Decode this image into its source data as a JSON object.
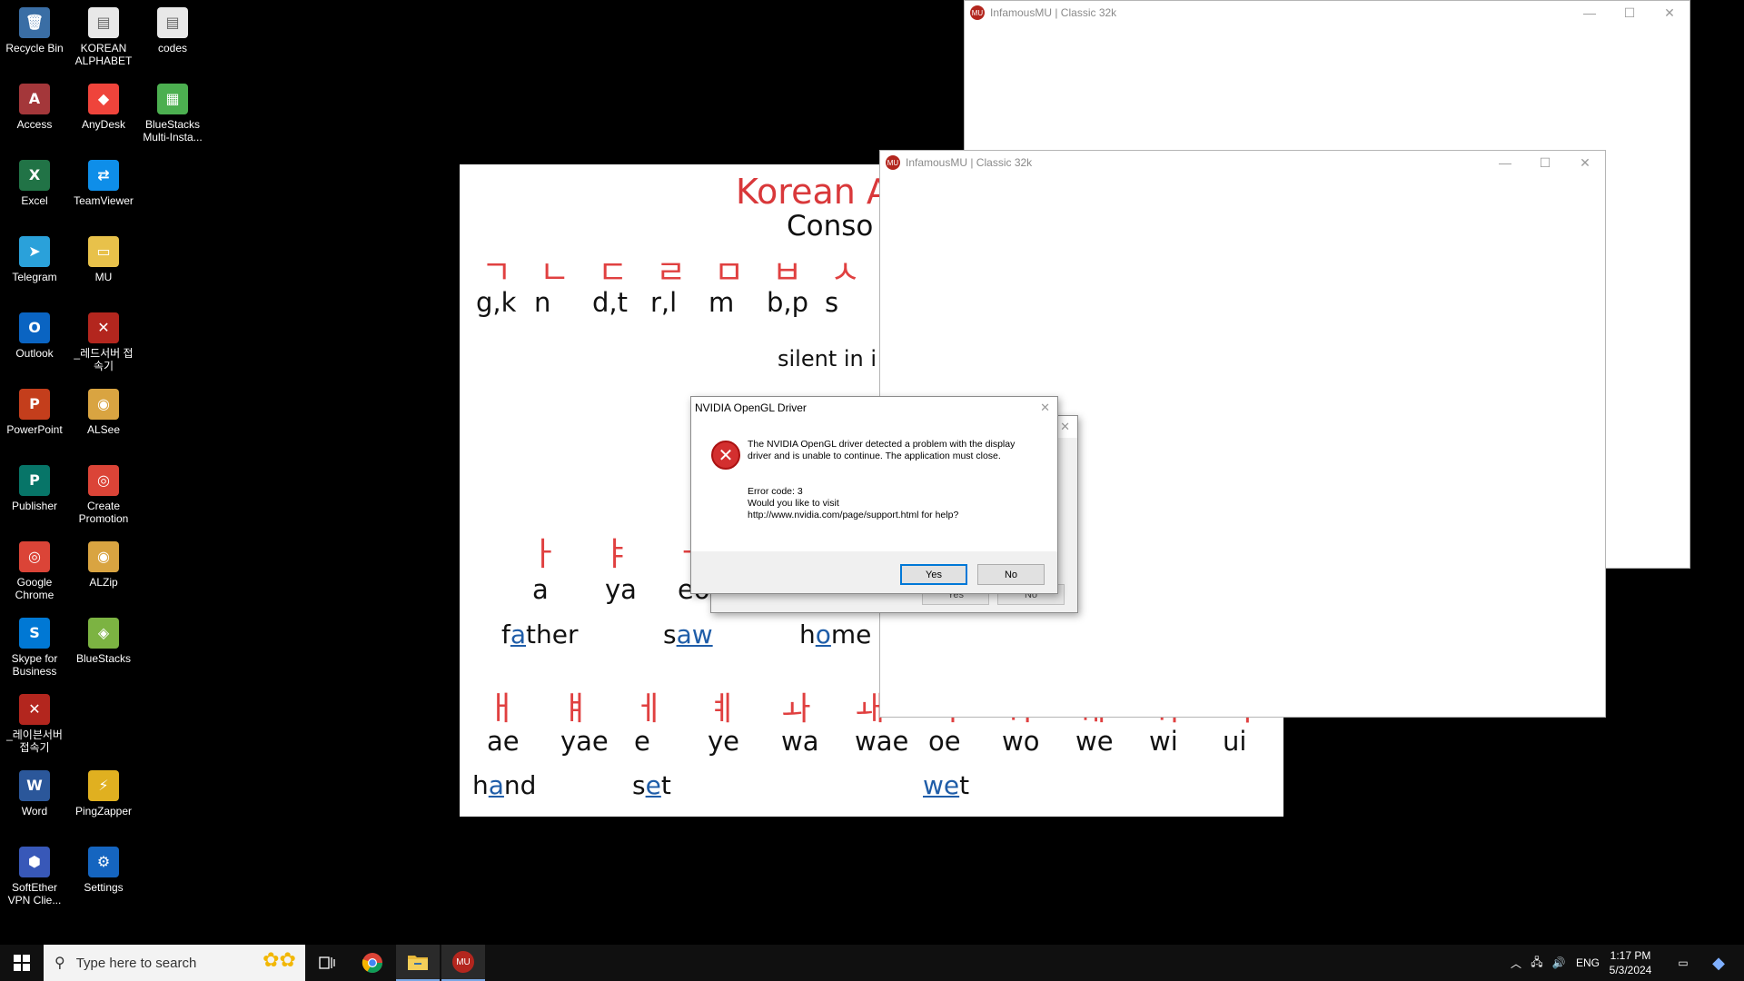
{
  "desktop": {
    "icons": [
      {
        "label": "Recycle Bin",
        "icon": "recycle-bin-icon",
        "glyph": "🗑",
        "color": "#3a6ea5"
      },
      {
        "label": "KOREAN ALPHABET",
        "icon": "document-icon",
        "glyph": "▤",
        "color": "#e8e8e8"
      },
      {
        "label": "codes",
        "icon": "document-icon",
        "glyph": "▤",
        "color": "#e8e8e8"
      },
      {
        "label": "Access",
        "icon": "access-icon",
        "glyph": "A",
        "color": "#a4373a"
      },
      {
        "label": "AnyDesk",
        "icon": "anydesk-icon",
        "glyph": "◆",
        "color": "#ef443b"
      },
      {
        "label": "BlueStacks Multi-Insta...",
        "icon": "bluestacks-multi-icon",
        "glyph": "▦",
        "color": "#4caf50"
      },
      {
        "label": "Excel",
        "icon": "excel-icon",
        "glyph": "X",
        "color": "#217346"
      },
      {
        "label": "TeamViewer",
        "icon": "teamviewer-icon",
        "glyph": "⇄",
        "color": "#0e8ee9"
      },
      {
        "label": "Telegram",
        "icon": "telegram-icon",
        "glyph": "➤",
        "color": "#2aa1da"
      },
      {
        "label": "MU",
        "icon": "folder-icon",
        "glyph": "▭",
        "color": "#e8c14a"
      },
      {
        "label": "Outlook",
        "icon": "outlook-icon",
        "glyph": "O",
        "color": "#0a64c2"
      },
      {
        "label": "_레드서버 접속기",
        "icon": "red-server-icon",
        "glyph": "✕",
        "color": "#b3261e"
      },
      {
        "label": "PowerPoint",
        "icon": "powerpoint-icon",
        "glyph": "P",
        "color": "#c43e1c"
      },
      {
        "label": "ALSee",
        "icon": "alsee-icon",
        "glyph": "◉",
        "color": "#d9a441"
      },
      {
        "label": "Publisher",
        "icon": "publisher-icon",
        "glyph": "P",
        "color": "#077568"
      },
      {
        "label": "Create Promotion",
        "icon": "chrome-icon",
        "glyph": "◎",
        "color": "#db4437"
      },
      {
        "label": "Google Chrome",
        "icon": "chrome-icon",
        "glyph": "◎",
        "color": "#db4437"
      },
      {
        "label": "ALZip",
        "icon": "alzip-icon",
        "glyph": "◉",
        "color": "#d9a441"
      },
      {
        "label": "Skype for Business",
        "icon": "skype-icon",
        "glyph": "S",
        "color": "#0078d4"
      },
      {
        "label": "BlueStacks",
        "icon": "bluestacks-icon",
        "glyph": "◈",
        "color": "#7cb342"
      },
      {
        "label": "_레이븐서버 접속기",
        "icon": "raven-server-icon",
        "glyph": "✕",
        "color": "#b3261e"
      },
      {
        "label": "Word",
        "icon": "word-icon",
        "glyph": "W",
        "color": "#2b579a"
      },
      {
        "label": "PingZapper",
        "icon": "pingzapper-icon",
        "glyph": "⚡",
        "color": "#e0b020"
      },
      {
        "label": "SoftEther VPN Clie...",
        "icon": "softether-icon",
        "glyph": "⬢",
        "color": "#3858b8"
      },
      {
        "label": "Settings",
        "icon": "settings-icon",
        "glyph": "⚙",
        "color": "#1565c0"
      }
    ]
  },
  "korean": {
    "title": "Korean A",
    "subtitle": "Conso",
    "consonants": [
      "ㄱ",
      "ㄴ",
      "ㄷ",
      "ㄹ",
      "ㅁ",
      "ㅂ",
      "ㅅ"
    ],
    "consonant_roman": [
      "g,k",
      "n",
      "d,t",
      "r,l",
      "m",
      "b,p",
      "s"
    ],
    "silent_note": "silent in i",
    "vowels1": [
      "ㅏ",
      "ㅑ",
      "ㅓ"
    ],
    "vowels1_roman": [
      "a",
      "ya",
      "eo"
    ],
    "example1": {
      "pre": "f",
      "hl": "a",
      "post": "ther"
    },
    "example2": {
      "pre": "s",
      "hl": "aw",
      "post": ""
    },
    "example3": {
      "pre": "h",
      "hl": "o",
      "post": "me"
    },
    "vowels2": [
      "ㅐ",
      "ㅒ",
      "ㅔ",
      "ㅖ",
      "ㅘ",
      "ㅙ",
      "ㅚ",
      "ㅝ",
      "ㅞ",
      "ㅟ",
      "ㅢ"
    ],
    "vowels2_roman": [
      "ae",
      "yae",
      "e",
      "ye",
      "wa",
      "wae",
      "oe",
      "wo",
      "we",
      "wi",
      "ui"
    ],
    "example4": {
      "pre": "h",
      "hl": "a",
      "post": "nd"
    },
    "example5": {
      "pre": "s",
      "hl": "e",
      "post": "t"
    },
    "example6": {
      "pre": "",
      "hl": "we",
      "post": "t"
    }
  },
  "windows": {
    "back_title": "InfamousMU | Classic 32k",
    "front_title": "InfamousMU | Classic 32k",
    "app_icon_text": "MU"
  },
  "dialog": {
    "title": "NVIDIA OpenGL Driver",
    "line1": "The NVIDIA OpenGL driver detected a problem with the display",
    "line2": "driver and is unable to continue. The application must close.",
    "line3": "Error code: 3",
    "line4": "Would you like to visit",
    "line5": "http://www.nvidia.com/page/support.html for help?",
    "yes": "Yes",
    "no": "No",
    "ghost_yes": "Yes",
    "ghost_no": "No"
  },
  "taskbar": {
    "search_placeholder": "Type here to search",
    "lang": "ENG",
    "time": "1:17 PM",
    "date": "5/3/2024"
  }
}
